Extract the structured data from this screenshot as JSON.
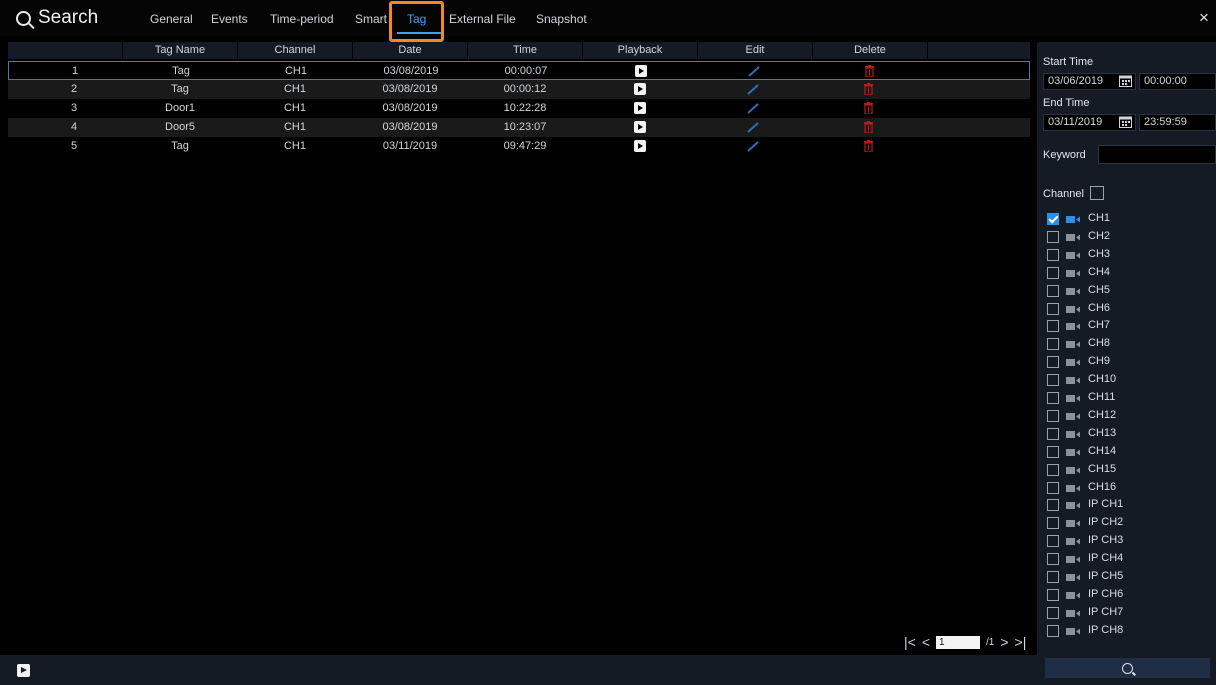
{
  "header": {
    "title": "Search",
    "tabs": [
      {
        "label": "General",
        "active": false
      },
      {
        "label": "Events",
        "active": false
      },
      {
        "label": "Time-period",
        "active": false
      },
      {
        "label": "Smart",
        "active": false
      },
      {
        "label": "Tag",
        "active": true
      },
      {
        "label": "External File",
        "active": false
      },
      {
        "label": "Snapshot",
        "active": false
      }
    ],
    "close_glyph": "×"
  },
  "table": {
    "columns": [
      "",
      "Tag Name",
      "Channel",
      "Date",
      "Time",
      "Playback",
      "Edit",
      "Delete"
    ],
    "rows": [
      {
        "no": "1",
        "tag_name": "Tag",
        "channel": "CH1",
        "date": "03/08/2019",
        "time": "00:00:07"
      },
      {
        "no": "2",
        "tag_name": "Tag",
        "channel": "CH1",
        "date": "03/08/2019",
        "time": "00:00:12"
      },
      {
        "no": "3",
        "tag_name": "Door1",
        "channel": "CH1",
        "date": "03/08/2019",
        "time": "10:22:28"
      },
      {
        "no": "4",
        "tag_name": "Door5",
        "channel": "CH1",
        "date": "03/08/2019",
        "time": "10:23:07"
      },
      {
        "no": "5",
        "tag_name": "Tag",
        "channel": "CH1",
        "date": "03/11/2019",
        "time": "09:47:29"
      }
    ],
    "selected_row": 1
  },
  "pagination": {
    "current": "1",
    "total": "/1"
  },
  "filters": {
    "start_time_label": "Start Time",
    "start_date": "03/06/2019",
    "start_time": "00:00:00",
    "end_time_label": "End Time",
    "end_date": "03/11/2019",
    "end_time": "23:59:59",
    "keyword_label": "Keyword",
    "keyword_value": "",
    "channel_label": "Channel",
    "channels": [
      {
        "label": "CH1",
        "checked": true
      },
      {
        "label": "CH2",
        "checked": false
      },
      {
        "label": "CH3",
        "checked": false
      },
      {
        "label": "CH4",
        "checked": false
      },
      {
        "label": "CH5",
        "checked": false
      },
      {
        "label": "CH6",
        "checked": false
      },
      {
        "label": "CH7",
        "checked": false
      },
      {
        "label": "CH8",
        "checked": false
      },
      {
        "label": "CH9",
        "checked": false
      },
      {
        "label": "CH10",
        "checked": false
      },
      {
        "label": "CH11",
        "checked": false
      },
      {
        "label": "CH12",
        "checked": false
      },
      {
        "label": "CH13",
        "checked": false
      },
      {
        "label": "CH14",
        "checked": false
      },
      {
        "label": "CH15",
        "checked": false
      },
      {
        "label": "CH16",
        "checked": false
      },
      {
        "label": "IP CH1",
        "checked": false
      },
      {
        "label": "IP CH2",
        "checked": false
      },
      {
        "label": "IP CH3",
        "checked": false
      },
      {
        "label": "IP CH4",
        "checked": false
      },
      {
        "label": "IP CH5",
        "checked": false
      },
      {
        "label": "IP CH6",
        "checked": false
      },
      {
        "label": "IP CH7",
        "checked": false
      },
      {
        "label": "IP CH8",
        "checked": false
      }
    ]
  },
  "colors": {
    "accent": "#39a2f5",
    "highlight": "#f28a23",
    "delete": "#c01818",
    "edit": "#2f6fb8"
  },
  "icons": {
    "search": "search-icon",
    "close": "close-icon",
    "playback": "play-icon",
    "edit": "pencil-icon",
    "delete": "trash-icon",
    "calendar": "calendar-icon",
    "camera": "camera-icon"
  }
}
